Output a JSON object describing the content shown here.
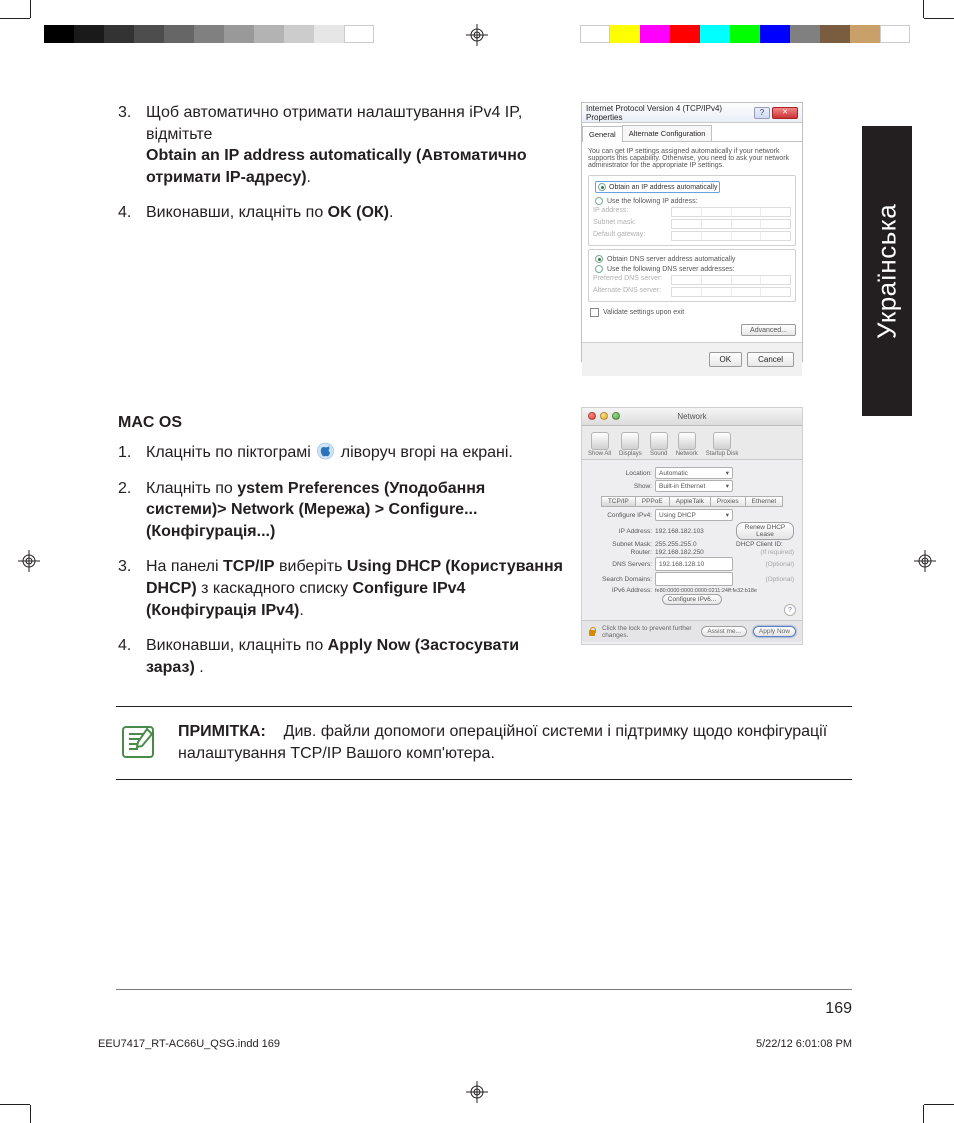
{
  "language_tab": "Українська",
  "section1": {
    "items": [
      {
        "num": "3.",
        "pre": "Щоб автоматично отримати налаштування iPv4 IP, відмітьте ",
        "bold": "Obtain an IP address automatically (Автоматично отримати IP-адресу)",
        "post": "."
      },
      {
        "num": "4.",
        "pre": "Виконавши, клацніть по ",
        "bold": "OK (ОК)",
        "post": "."
      }
    ]
  },
  "mac_heading": "MAC OS",
  "section2": {
    "items": [
      {
        "num": "1.",
        "pre": "Клацніть по піктограмі ",
        "bold": "",
        "post": " ліворуч вгорі на екрані."
      },
      {
        "num": "2.",
        "pre": "Клацніть по ",
        "bold": "ystem Preferences (Уподобання системи)> Network (Мережа) > Configure... (Конфігурація...)",
        "post": ""
      },
      {
        "num": "3.",
        "pre": "На панелі ",
        "bold": "TCP/IP",
        "mid": " виберіть ",
        "bold2": "Using DHCP (Користування DHCP)",
        "mid2": " з каскадного списку ",
        "bold3": "Configure IPv4 (Конфігурація IPv4)",
        "post": "."
      },
      {
        "num": "4.",
        "pre": "Виконавши, клацніть по ",
        "bold": "Apply Now (Застосувати зараз)",
        "post": " ."
      }
    ]
  },
  "note": {
    "label": "ПРИМІТКА:",
    "body": "Див. файли допомоги операційної системи і підтримку щодо конфігурації налаштування TCP/IP Вашого комп'ютера."
  },
  "page_number": "169",
  "slug_left": "EEU7417_RT-AC66U_QSG.indd   169",
  "slug_right": "5/22/12   6:01:08 PM",
  "win_dialog": {
    "title": "Internet Protocol Version 4 (TCP/IPv4) Properties",
    "tab_general": "General",
    "tab_alt": "Alternate Configuration",
    "desc": "You can get IP settings assigned automatically if your network supports this capability. Otherwise, you need to ask your network administrator for the appropriate IP settings.",
    "opt_auto_ip": "Obtain an IP address automatically",
    "opt_use_ip": "Use the following IP address:",
    "lbl_ip": "IP address:",
    "lbl_subnet": "Subnet mask:",
    "lbl_gateway": "Default gateway:",
    "opt_auto_dns": "Obtain DNS server address automatically",
    "opt_use_dns": "Use the following DNS server addresses:",
    "lbl_pref_dns": "Preferred DNS server:",
    "lbl_alt_dns": "Alternate DNS server:",
    "chk_validate": "Validate settings upon exit",
    "btn_adv": "Advanced...",
    "btn_ok": "OK",
    "btn_cancel": "Cancel"
  },
  "mac_dialog": {
    "title": "Network",
    "tools": [
      "Show All",
      "Displays",
      "Sound",
      "Network",
      "Startup Disk"
    ],
    "lbl_location": "Location:",
    "val_location": "Automatic",
    "lbl_show": "Show:",
    "val_show": "Built-in Ethernet",
    "tabs": [
      "TCP/IP",
      "PPPoE",
      "AppleTalk",
      "Proxies",
      "Ethernet"
    ],
    "lbl_configure": "Configure IPv4:",
    "val_configure": "Using DHCP",
    "lbl_ip": "IP Address:",
    "val_ip": "192.168.182.103",
    "btn_renew": "Renew DHCP Lease",
    "lbl_subnet": "Subnet Mask:",
    "val_subnet": "255.255.255.0",
    "lbl_client": "DHCP Client ID:",
    "hint_client": "(If required)",
    "lbl_router": "Router:",
    "val_router": "192.168.182.250",
    "lbl_dns": "DNS Servers:",
    "val_dns": "192.168.128.10",
    "hint_opt": "(Optional)",
    "lbl_search": "Search Domains:",
    "lbl_ipv6": "IPv6 Address:",
    "val_ipv6": "fe80:0000:0000:0000:0211:24ff:fe32:b18e",
    "btn_ipv6": "Configure IPv6...",
    "lock_text": "Click the lock to prevent further changes.",
    "btn_assist": "Assist me...",
    "btn_apply": "Apply Now"
  },
  "colorbars": {
    "left": [
      "#000000",
      "#1a1a1a",
      "#333333",
      "#4d4d4d",
      "#666666",
      "#808080",
      "#999999",
      "#b3b3b3",
      "#cccccc",
      "#e6e6e6",
      "#ffffff"
    ],
    "right": [
      "#ffffff",
      "#ffff00",
      "#ff00ff",
      "#ff0000",
      "#00ffff",
      "#00ff00",
      "#0000ff",
      "#808080",
      "#7a5c3e",
      "#caa06a",
      "#ffffff"
    ]
  }
}
